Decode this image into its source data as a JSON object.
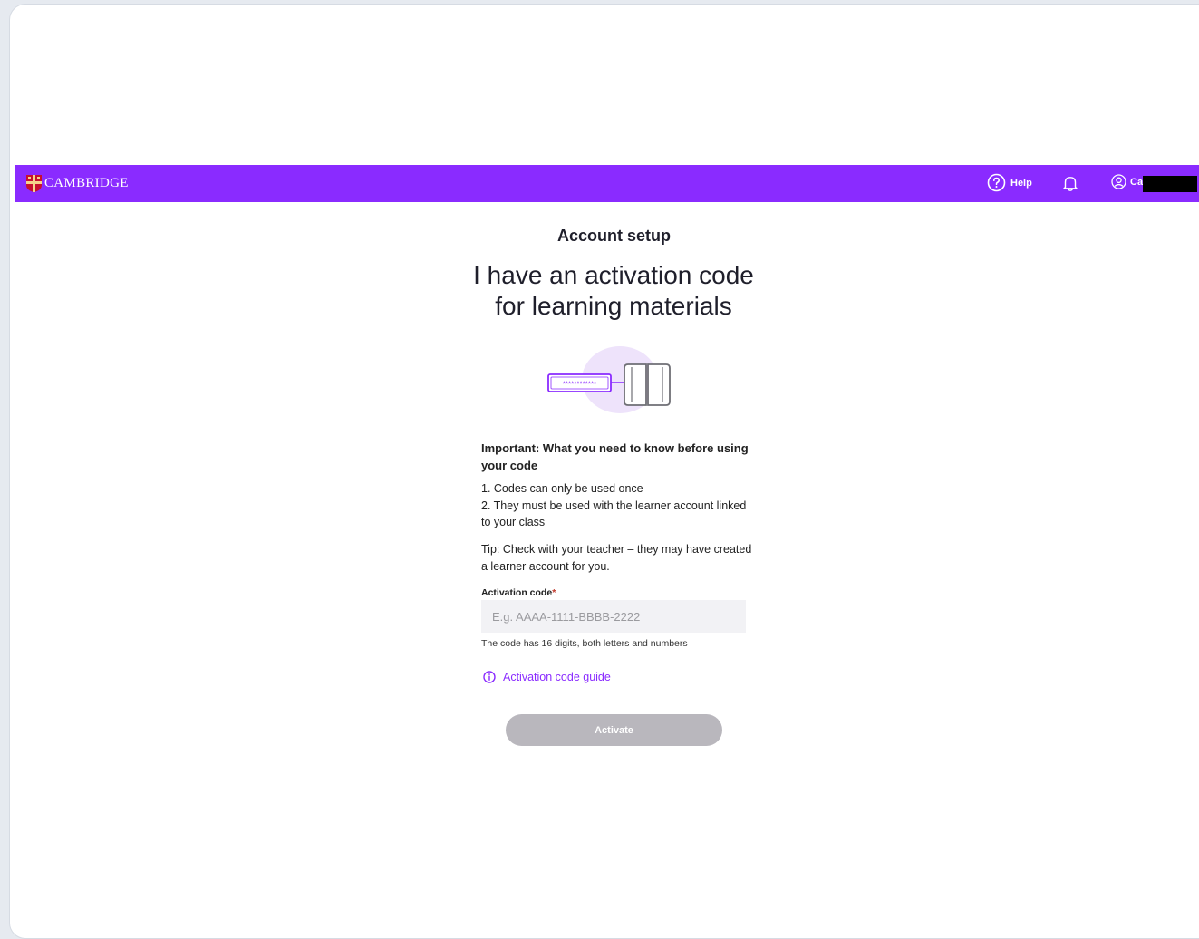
{
  "header": {
    "brand": "CAMBRIDGE",
    "help_label": "Help",
    "user_name": "Ca",
    "brand_color": "#8a2bff"
  },
  "main": {
    "eyebrow": "Account setup",
    "heading_line1": "I have an activation code",
    "heading_line2": "for learning materials",
    "illustration_code": "************",
    "important_title": "Important: What you need to know before using your code",
    "rules": [
      "1. Codes can only be used once",
      "2. They must be used with the learner account linked to your class"
    ],
    "tip": "Tip: Check with your teacher – they may have created a learner account for you.",
    "field_label": "Activation code",
    "required_mark": "*",
    "placeholder": "E.g. AAAA-1111-BBBB-2222",
    "hint": "The code has 16 digits, both letters and numbers",
    "guide_link": "Activation code guide",
    "activate_label": "Activate"
  }
}
